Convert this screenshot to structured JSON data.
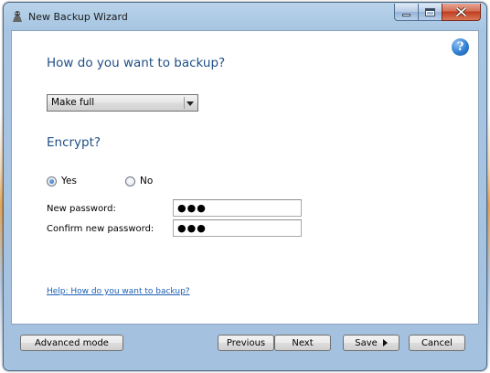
{
  "window": {
    "title": "New Backup Wizard",
    "icon": "backup-wizard-icon"
  },
  "help_icon": "help-icon",
  "backup": {
    "heading": "How do you want to backup?",
    "mode_selected": "Make full"
  },
  "encrypt": {
    "heading": "Encrypt?",
    "option_yes": "Yes",
    "option_no": "No",
    "selected": "Yes"
  },
  "password": {
    "new_label": "New password:",
    "new_value": "●●●",
    "confirm_label": "Confirm new password:",
    "confirm_value": "●●●"
  },
  "help_link": "Help: How do you want to backup?",
  "buttons": {
    "advanced": "Advanced mode",
    "previous": "Previous",
    "next": "Next",
    "save": "Save",
    "cancel": "Cancel"
  },
  "colors": {
    "heading": "#1f4f86",
    "link": "#1a5fb4",
    "frame": "#a7c5e2",
    "close_button": "#c13d1f"
  }
}
